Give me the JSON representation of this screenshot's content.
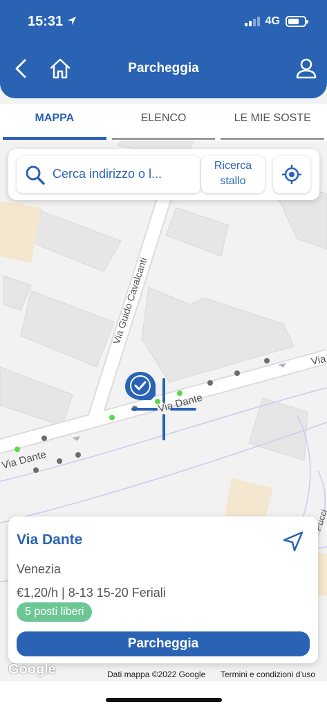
{
  "status_bar": {
    "time": "15:31",
    "network": "4G"
  },
  "header": {
    "title": "Parcheggia"
  },
  "tabs": [
    {
      "label": "MAPPA",
      "active": true
    },
    {
      "label": "ELENCO",
      "active": false
    },
    {
      "label": "LE MIE SOSTE",
      "active": false
    }
  ],
  "search": {
    "placeholder": "Cerca indirizzo o l...",
    "stall_button_line1": "Ricerca",
    "stall_button_line2": "stallo"
  },
  "map": {
    "street_labels": [
      "Via Guido Cavalcanti",
      "Via Dante",
      "Via Dante",
      "Via",
      "Pucci"
    ],
    "credit": "Dati mappa ©2022 Google",
    "terms": "Termini e condizioni d'uso",
    "logo": "Google"
  },
  "info_card": {
    "street": "Via Dante",
    "city": "Venezia",
    "rate": "€1,20/h | 8-13 15-20 Feriali",
    "free_spots": "5 posti liberi",
    "park_button": "Parcheggia"
  },
  "colors": {
    "primary": "#2a63b4",
    "free_green": "#6cc795",
    "free_dot": "#5cd84a",
    "occupied_dot": "#6d6d6d"
  }
}
